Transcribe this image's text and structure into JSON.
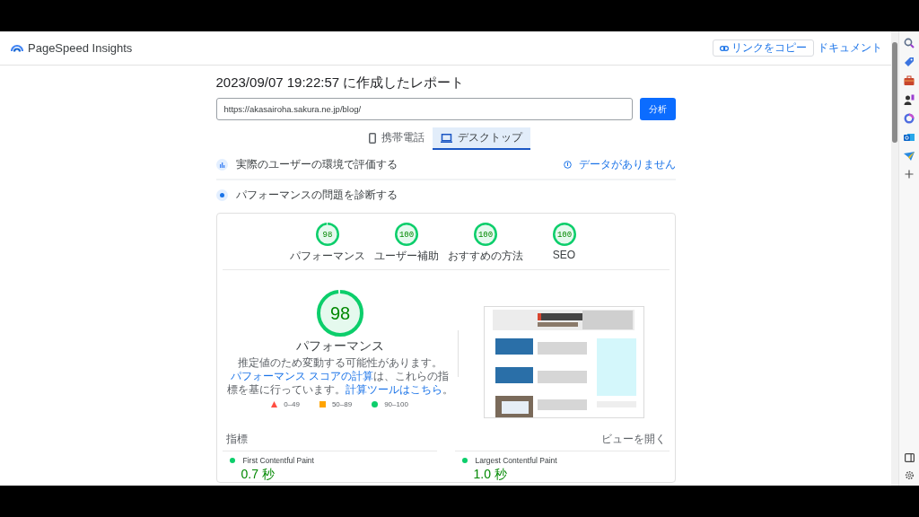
{
  "header": {
    "title": "PageSpeed Insights",
    "copy_link": "リンクをコピー",
    "docs": "ドキュメント"
  },
  "report_title": "2023/09/07 19:22:57 に作成したレポート",
  "url_field": {
    "value": "https://akasairoha.sakura.ne.jp/blog/"
  },
  "analyze_button": "分析",
  "tabs": [
    {
      "label": "携帯電話",
      "kind": "phone",
      "selected": false
    },
    {
      "label": "デスクトップ",
      "kind": "desktop",
      "selected": true
    }
  ],
  "field_section": {
    "title": "実際のユーザーの環境で評価する",
    "status": "データがありません"
  },
  "lab_section": {
    "title": "パフォーマンスの問題を診断する"
  },
  "scores": [
    {
      "score": "98",
      "label": "パフォーマンス",
      "level": 0.98
    },
    {
      "score": "100",
      "label": "ユーザー補助",
      "level": 1
    },
    {
      "score": "100",
      "label": "おすすめの方法",
      "level": 1
    },
    {
      "score": "100",
      "label": "SEO",
      "level": 1
    }
  ],
  "performance": {
    "score": "98",
    "level": 0.98,
    "label": "パフォーマンス",
    "note": [
      {
        "kind": "text",
        "text": "推定値のため変動する可能性があります。"
      },
      {
        "kind": "link",
        "text": "パフォーマンス スコアの計算"
      },
      {
        "kind": "text",
        "text": "は、これらの指標を基に行っています。"
      },
      {
        "kind": "link",
        "text": "計算ツールはこちら"
      },
      {
        "kind": "text",
        "text": "。"
      }
    ],
    "legend": [
      {
        "kind": "fail",
        "label": "0–49"
      },
      {
        "kind": "average",
        "label": "50–89"
      },
      {
        "kind": "pass",
        "label": "90–100"
      }
    ]
  },
  "metrics": {
    "title": "指標",
    "expand": "ビューを開く",
    "items": [
      {
        "name": "First Contentful Paint",
        "value": "0.7 秒",
        "kind": "pass"
      },
      {
        "name": "Largest Contentful Paint",
        "value": "1.0 秒",
        "kind": "pass"
      }
    ]
  }
}
